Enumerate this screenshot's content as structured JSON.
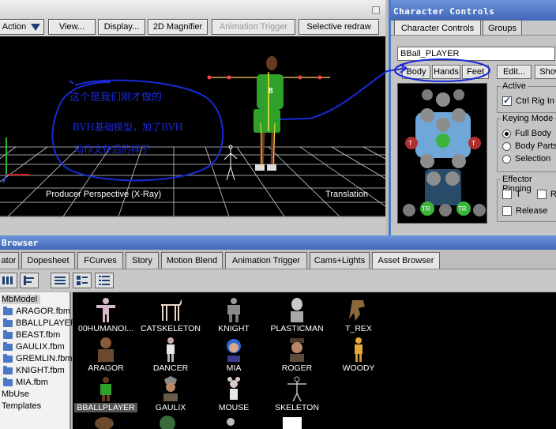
{
  "toolbar": {
    "action_label": "Action",
    "view_label": "View...",
    "display_label": "Display...",
    "magnifier_label": "2D Magnifier",
    "anim_trigger_label": "Animation Trigger",
    "selective_redraw_label": "Selective redraw"
  },
  "viewport": {
    "annotation_line1": "这个是我们刚才做的",
    "annotation_line2": "BVH基础模型，加了BVH",
    "annotation_line3": "动作文件后的样子",
    "perspective_label": "Producer Perspective (X-Ray)",
    "mode_label": "Translation",
    "jersey_number": "8"
  },
  "character_controls": {
    "title": "Character Controls",
    "tabs": [
      "Character Controls",
      "Groups"
    ],
    "character_name": "BBall_PLAYER",
    "buttons": [
      "Body",
      "Hands",
      "Feet",
      "Edit...",
      "Show"
    ],
    "active_group": "Active",
    "ctrl_rig_label": "Ctrl Rig In",
    "keying_group": "Keying Mode",
    "keying_options": [
      "Full Body",
      "Body Parts",
      "Selection"
    ],
    "effector_group": "Effector Pinning",
    "pin_t": "T",
    "pin_r": "R",
    "release_label": "Release",
    "fig_markers": {
      "t_left": "T",
      "t_right": "T",
      "tr_left": "TR",
      "tr_right": "TR"
    }
  },
  "browser": {
    "title": "Browser",
    "tabs": [
      "ator",
      "Dopesheet",
      "FCurves",
      "Story",
      "Motion Blend",
      "Animation Trigger",
      "Cams+Lights",
      "Asset Browser"
    ],
    "tree": [
      "MbModel",
      "ARAGOR.fbm",
      "BBALLPLAYER",
      "BEAST.fbm",
      "GAULIX.fbm",
      "GREMLIN.fbm",
      "KNIGHT.fbm",
      "MIA.fbm",
      "MbUse",
      "Templates"
    ],
    "assets": [
      "00HUMANOI...",
      "CATSKELETON",
      "KNIGHT",
      "PLASTICMAN",
      "T_REX",
      "ARAGOR",
      "DANCER",
      "MIA",
      "ROGER",
      "WOODY",
      "BBALLPLAYER",
      "GAULIX",
      "MOUSE",
      "SKELETON"
    ]
  },
  "colors": {
    "accent_title": "#4b78c8",
    "annotation_ink": "#1a2ad8",
    "jersey_green": "#2fa02a",
    "grid": "#cfcfcf"
  }
}
